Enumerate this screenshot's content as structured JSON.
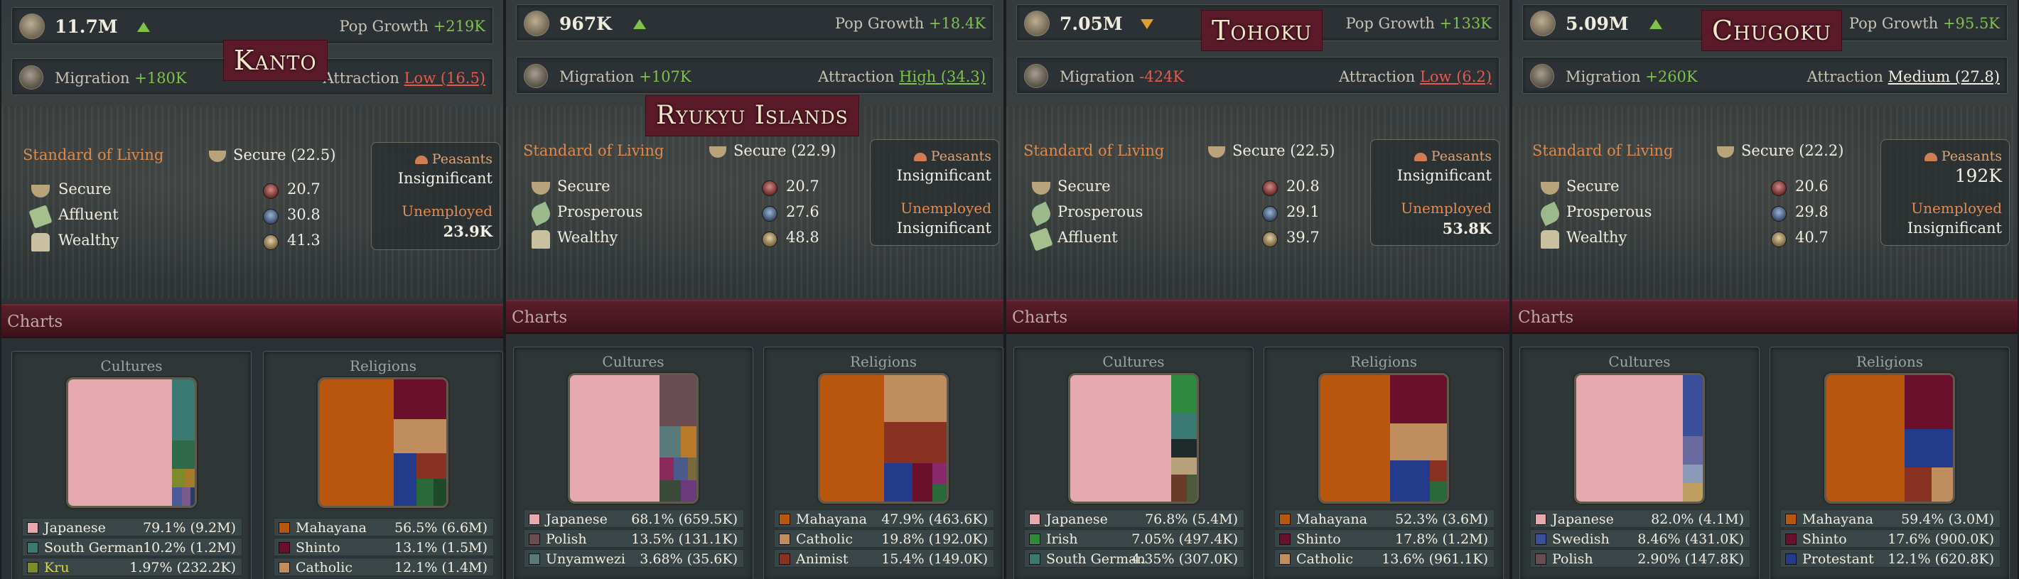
{
  "panels": [
    {
      "region": "Kanto",
      "population": "11.7M",
      "trend": "up",
      "pop_growth_label": "Pop Growth",
      "pop_growth": "+219K",
      "migration_label": "Migration",
      "migration": "+180K",
      "migration_sign": "pos",
      "attraction_label": "Attraction",
      "attraction": "Low (16.5)",
      "attraction_level": "low",
      "sol_label": "Standard of Living",
      "sol_value": "Secure (22.5)",
      "strata": [
        {
          "name": "Secure",
          "icon": "cup",
          "value": "20.7",
          "value_icon": "red"
        },
        {
          "name": "Affluent",
          "icon": "money",
          "value": "30.8",
          "value_icon": "blue"
        },
        {
          "name": "Wealthy",
          "icon": "chair",
          "value": "41.3",
          "value_icon": "tan"
        }
      ],
      "peasants_label": "Peasants",
      "peasants": "Insignificant",
      "unemployed_label": "Unemployed",
      "unemployed": "23.9K",
      "charts_label": "Charts",
      "cultures_title": "Cultures",
      "religions_title": "Religions",
      "cultures": [
        {
          "name": "Japanese",
          "pct": "79.1% (9.2M)",
          "color": "#e5a8ac"
        },
        {
          "name": "South German",
          "pct": "10.2% (1.2M)",
          "color": "#3a7a72"
        },
        {
          "name": "Kru",
          "pct": "1.97% (232.2K)",
          "color": "#7c8c2a"
        }
      ],
      "religions": [
        {
          "name": "Mahayana",
          "pct": "56.5% (6.6M)",
          "color": "#b8560e"
        },
        {
          "name": "Shinto",
          "pct": "13.1% (1.5M)",
          "color": "#6a0f2c"
        },
        {
          "name": "Catholic",
          "pct": "12.1% (1.4M)",
          "color": "#c08d5e"
        }
      ]
    },
    {
      "region": "Ryukyu Islands",
      "population": "967K",
      "trend": "up",
      "pop_growth_label": "Pop Growth",
      "pop_growth": "+18.4K",
      "migration_label": "Migration",
      "migration": "+107K",
      "migration_sign": "pos",
      "attraction_label": "Attraction",
      "attraction": "High (34.3)",
      "attraction_level": "high",
      "sol_label": "Standard of Living",
      "sol_value": "Secure (22.9)",
      "strata": [
        {
          "name": "Secure",
          "icon": "cup",
          "value": "20.7",
          "value_icon": "red"
        },
        {
          "name": "Prosperous",
          "icon": "leaf",
          "value": "27.6",
          "value_icon": "blue"
        },
        {
          "name": "Wealthy",
          "icon": "chair",
          "value": "48.8",
          "value_icon": "tan"
        }
      ],
      "peasants_label": "Peasants",
      "peasants": "Insignificant",
      "unemployed_label": "Unemployed",
      "unemployed": "Insignificant",
      "charts_label": "Charts",
      "cultures_title": "Cultures",
      "religions_title": "Religions",
      "cultures": [
        {
          "name": "Japanese",
          "pct": "68.1% (659.5K)",
          "color": "#e5a8ac"
        },
        {
          "name": "Polish",
          "pct": "13.5% (131.1K)",
          "color": "#6a4d52"
        },
        {
          "name": "Unyamwezi",
          "pct": "3.68% (35.6K)",
          "color": "#5a7a7a"
        }
      ],
      "religions": [
        {
          "name": "Mahayana",
          "pct": "47.9% (463.6K)",
          "color": "#b8560e"
        },
        {
          "name": "Catholic",
          "pct": "19.8% (192.0K)",
          "color": "#c08d5e"
        },
        {
          "name": "Animist",
          "pct": "15.4% (149.0K)",
          "color": "#8a3222"
        }
      ]
    },
    {
      "region": "Tohoku",
      "population": "7.05M",
      "trend": "down",
      "pop_growth_label": "Pop Growth",
      "pop_growth": "+133K",
      "migration_label": "Migration",
      "migration": "-424K",
      "migration_sign": "neg",
      "attraction_label": "Attraction",
      "attraction": "Low (6.2)",
      "attraction_level": "low",
      "sol_label": "Standard of Living",
      "sol_value": "Secure (22.5)",
      "strata": [
        {
          "name": "Secure",
          "icon": "cup",
          "value": "20.8",
          "value_icon": "red"
        },
        {
          "name": "Prosperous",
          "icon": "leaf",
          "value": "29.1",
          "value_icon": "blue"
        },
        {
          "name": "Affluent",
          "icon": "money",
          "value": "39.7",
          "value_icon": "tan"
        }
      ],
      "peasants_label": "Peasants",
      "peasants": "Insignificant",
      "unemployed_label": "Unemployed",
      "unemployed": "53.8K",
      "charts_label": "Charts",
      "cultures_title": "Cultures",
      "religions_title": "Religions",
      "cultures": [
        {
          "name": "Japanese",
          "pct": "76.8% (5.4M)",
          "color": "#e5a8ac"
        },
        {
          "name": "Irish",
          "pct": "7.05% (497.4K)",
          "color": "#2f8a3e"
        },
        {
          "name": "South German",
          "pct": "4.35% (307.0K)",
          "color": "#3a7a72"
        }
      ],
      "religions": [
        {
          "name": "Mahayana",
          "pct": "52.3% (3.6M)",
          "color": "#b8560e"
        },
        {
          "name": "Shinto",
          "pct": "17.8% (1.2M)",
          "color": "#6a0f2c"
        },
        {
          "name": "Catholic",
          "pct": "13.6% (961.1K)",
          "color": "#c08d5e"
        }
      ]
    },
    {
      "region": "Chugoku",
      "population": "5.09M",
      "trend": "up",
      "pop_growth_label": "Pop Growth",
      "pop_growth": "+95.5K",
      "migration_label": "Migration",
      "migration": "+260K",
      "migration_sign": "pos",
      "attraction_label": "Attraction",
      "attraction": "Medium (27.8)",
      "attraction_level": "medium",
      "sol_label": "Standard of Living",
      "sol_value": "Secure (22.2)",
      "strata": [
        {
          "name": "Secure",
          "icon": "cup",
          "value": "20.6",
          "value_icon": "red"
        },
        {
          "name": "Prosperous",
          "icon": "leaf",
          "value": "29.8",
          "value_icon": "blue"
        },
        {
          "name": "Wealthy",
          "icon": "chair",
          "value": "40.7",
          "value_icon": "tan"
        }
      ],
      "peasants_label": "Peasants",
      "peasants": "192K",
      "unemployed_label": "Unemployed",
      "unemployed": "Insignificant",
      "charts_label": "Charts",
      "cultures_title": "Cultures",
      "religions_title": "Religions",
      "cultures": [
        {
          "name": "Japanese",
          "pct": "82.0% (4.1M)",
          "color": "#e5a8ac"
        },
        {
          "name": "Swedish",
          "pct": "8.46% (431.0K)",
          "color": "#3a4f9a"
        },
        {
          "name": "Polish",
          "pct": "2.90% (147.8K)",
          "color": "#6a4d52"
        }
      ],
      "religions": [
        {
          "name": "Mahayana",
          "pct": "59.4% (3.0M)",
          "color": "#b8560e"
        },
        {
          "name": "Shinto",
          "pct": "17.6% (900.0K)",
          "color": "#6a0f2c"
        },
        {
          "name": "Protestant",
          "pct": "12.1% (620.8K)",
          "color": "#243a8a"
        }
      ]
    }
  ]
}
